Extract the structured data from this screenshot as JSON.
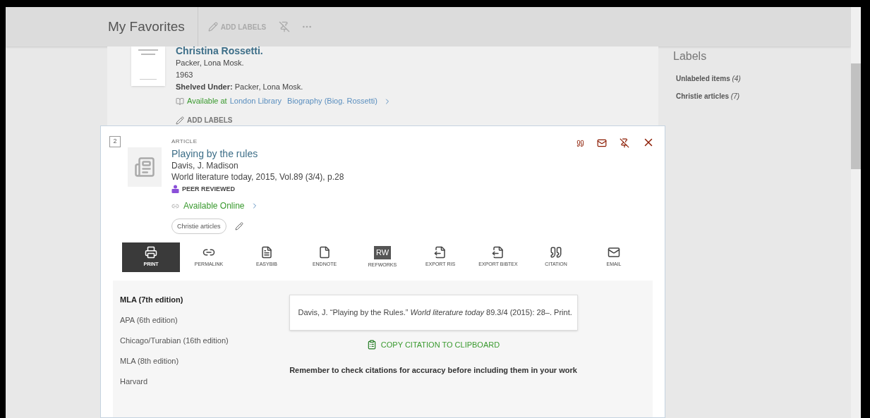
{
  "header": {
    "title": "My Favorites",
    "add_labels": "ADD LABELS"
  },
  "previous_item": {
    "title": "Christina Rossetti.",
    "author": "Packer, Lona Mosk.",
    "year": "1963",
    "shelved_label": "Shelved Under:",
    "shelved_value": "Packer, Lona Mosk.",
    "availability": "Available at",
    "library": "London Library",
    "location": "Biography (Biog. Rossetti)",
    "add_labels": "ADD LABELS"
  },
  "card": {
    "number": "2",
    "type": "ARTICLE",
    "title": "Playing by the rules",
    "author": "Davis, J. Madison",
    "source": "World literature today, 2015, Vol.89 (3/4), p.28",
    "peer_reviewed": "PEER REVIEWED",
    "availability": "Available Online",
    "labels": [
      "Christie articles"
    ],
    "actions": [
      {
        "kind": "print",
        "label": "PRINT",
        "selected": true
      },
      {
        "kind": "link",
        "label": "PERMALINK",
        "selected": false
      },
      {
        "kind": "easybib",
        "label": "EASYBIB",
        "selected": false
      },
      {
        "kind": "file",
        "label": "ENDNOTE",
        "selected": false
      },
      {
        "kind": "badge",
        "badge": "RW",
        "label": "REFWORKS",
        "selected": false
      },
      {
        "kind": "export",
        "label": "EXPORT RIS",
        "selected": false
      },
      {
        "kind": "export",
        "label": "EXPORT BIBTEX",
        "selected": false
      },
      {
        "kind": "quote",
        "label": "CITATION",
        "selected": false
      },
      {
        "kind": "mail",
        "label": "EMAIL",
        "selected": false
      }
    ],
    "citation_styles": [
      {
        "label": "MLA (7th edition)",
        "selected": true
      },
      {
        "label": "APA (6th edition)",
        "selected": false
      },
      {
        "label": "Chicago/Turabian (16th edition)",
        "selected": false
      },
      {
        "label": "MLA (8th edition)",
        "selected": false
      },
      {
        "label": "Harvard",
        "selected": false
      }
    ],
    "citation": "Davis, J. “Playing by the Rules.” *World literature today* 89.3/4 (2015): 28–. Print.",
    "copy_button": "COPY CITATION TO CLIPBOARD",
    "note": "Remember to check citations for accuracy before including them in your work"
  },
  "sidebar": {
    "title": "Labels",
    "items": [
      {
        "label": "Unlabeled items",
        "count": "(4)"
      },
      {
        "label": "Christie articles",
        "count": "(7)"
      }
    ]
  }
}
